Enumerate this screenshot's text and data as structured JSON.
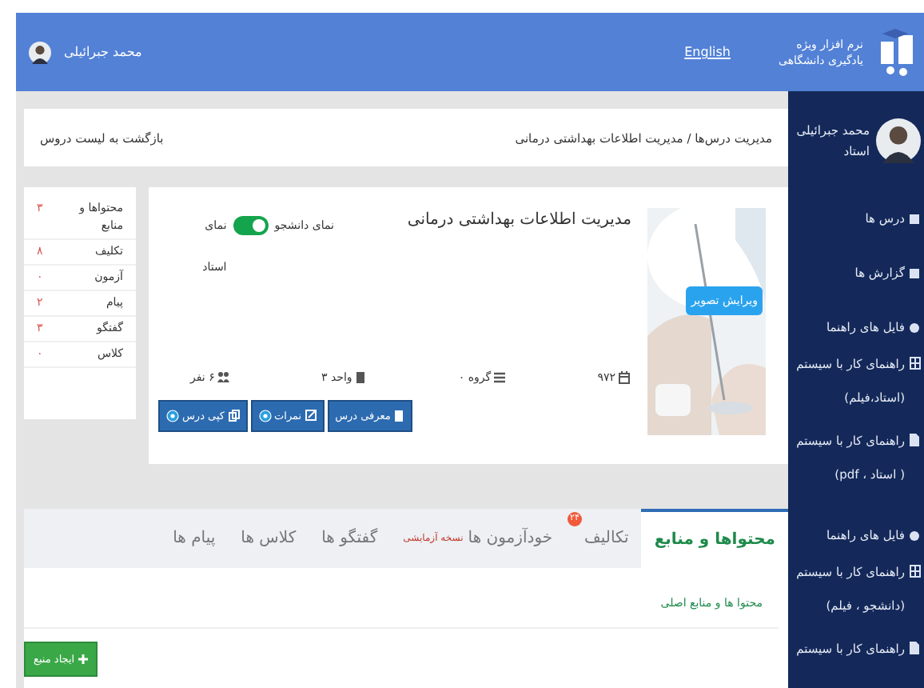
{
  "header": {
    "brand_line_1": "نرم افزار ویژه",
    "brand_line_2": "یادگیری دانشگاهی",
    "language_link": "English",
    "user_name": "محمد جبرائیلی"
  },
  "sidebar": {
    "profile": {
      "name": "محمد جبرائیلی",
      "role": "استاد"
    },
    "items": [
      {
        "kind": "link",
        "label": "درس ها"
      },
      {
        "kind": "link",
        "label": "گزارش ها"
      },
      {
        "kind": "group",
        "label": "فایل های راهنما",
        "children": [
          {
            "kind": "film",
            "label": "راهنمای کار با سیستم (استاد،فیلم)"
          },
          {
            "kind": "pdf",
            "label": "راهنمای کار با سیستم ( استاد ، pdf)"
          }
        ]
      },
      {
        "kind": "group",
        "label": "فایل های راهنما",
        "children": [
          {
            "kind": "film",
            "label": "راهنمای کار با سیستم (دانشجو ، فیلم)"
          },
          {
            "kind": "pdf",
            "label": "راهنمای کار با سیستم"
          }
        ]
      }
    ]
  },
  "breadcrumb": {
    "path": "مدیریت درس‌ها / مدیریت اطلاعات بهداشتی درمانی",
    "back_link": "بازگشت به لیست دروس"
  },
  "course": {
    "title": "مدیریت اطلاعات بهداشتی درمانی",
    "image_button": "ویرایش تصویر",
    "view_toggle": {
      "right_label": "نمای دانشجو",
      "left_label": "نمای استاد",
      "on": true
    },
    "info": [
      {
        "kind": "code",
        "text": "۹۷۲"
      },
      {
        "kind": "group",
        "text": "گروه ۰"
      },
      {
        "kind": "units",
        "text": "واحد ۳"
      },
      {
        "kind": "people",
        "text": "۶ نفر"
      }
    ],
    "buttons": [
      {
        "kind": "intro",
        "label": "معرفی درس",
        "help": false
      },
      {
        "kind": "grades",
        "label": "نمرات",
        "help": true
      },
      {
        "kind": "copy",
        "label": "کپی درس",
        "help": true
      }
    ]
  },
  "stats": [
    {
      "label": "محتواها و منابع",
      "count": "۳"
    },
    {
      "label": "تکلیف",
      "count": "۸"
    },
    {
      "label": "آزمون",
      "count": "۰"
    },
    {
      "label": "پیام",
      "count": "۲"
    },
    {
      "label": "گفتگو",
      "count": "۳"
    },
    {
      "label": "کلاس",
      "count": "۰"
    }
  ],
  "tabs": [
    {
      "label": "محتواها و منابع",
      "selected": true
    },
    {
      "label": "تکالیف",
      "selected": false,
      "badge": "۲۴"
    },
    {
      "label": "خودآزمون ها",
      "selected": false,
      "note": "نسخه آزمایشی"
    },
    {
      "label": "گفتگو ها",
      "selected": false
    },
    {
      "label": "کلاس ها",
      "selected": false
    },
    {
      "label": "پیام ها",
      "selected": false
    }
  ],
  "content": {
    "section_title": "محتوا ها و منابع اصلی",
    "create_button": "ایجاد منبع"
  }
}
